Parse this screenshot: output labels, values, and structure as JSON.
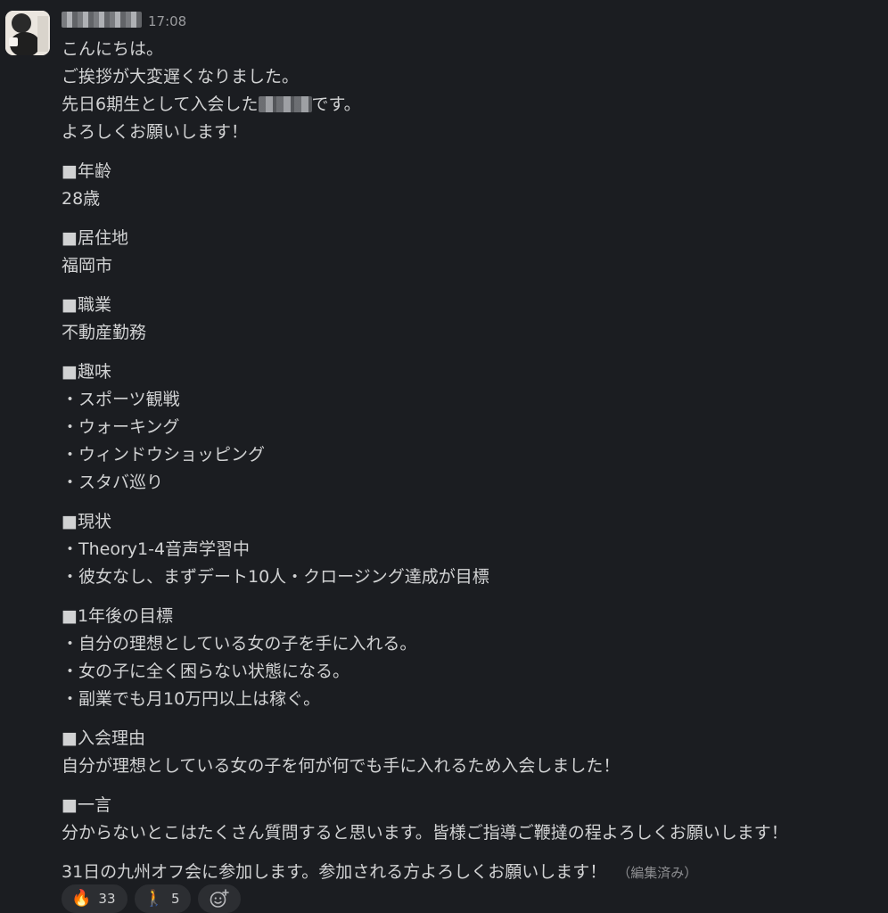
{
  "message": {
    "timestamp": "17:08",
    "greeting": [
      "こんにちは。",
      "ご挨拶が大変遅くなりました。"
    ],
    "intro_prefix": "先日6期生として入会した",
    "intro_suffix": "です。",
    "intro_closing": "よろしくお願いします！",
    "sections": {
      "age": {
        "title": "■年齢",
        "lines": [
          " 28歳"
        ]
      },
      "residence": {
        "title": "■居住地",
        "lines": [
          "福岡市"
        ]
      },
      "occupation": {
        "title": "■職業",
        "lines": [
          "不動産勤務"
        ]
      },
      "hobbies": {
        "title": "■趣味",
        "lines": [
          "・スポーツ観戦",
          "・ウォーキング",
          "・ウィンドウショッピング",
          "・スタバ巡り"
        ]
      },
      "status": {
        "title": "■現状",
        "lines": [
          "・Theory1-4音声学習中",
          "・彼女なし、まずデート10人・クロージング達成が目標"
        ]
      },
      "goals": {
        "title": "■1年後の目標",
        "lines": [
          "・自分の理想としている女の子を手に入れる。",
          "・女の子に全く困らない状態になる。",
          "・副業でも月10万円以上は稼ぐ。"
        ]
      },
      "reason": {
        "title": "■入会理由",
        "lines": [
          "自分が理想としている女の子を何が何でも手に入れるため入会しました！"
        ]
      },
      "comment": {
        "title": "■一言",
        "lines": [
          "分からないとこはたくさん質問すると思います。皆様ご指導ご鞭撻の程よろしくお願いします！"
        ]
      }
    },
    "final_line": "31日の九州オフ会に参加します。参加される方よろしくお願いします！",
    "edited_label": "（編集済み）"
  },
  "reactions": [
    {
      "emoji": "🔥",
      "icon": "fire-icon",
      "count": "33"
    },
    {
      "emoji": "🚶",
      "icon": "walking-person-icon",
      "count": "5"
    }
  ],
  "add_reaction_icon": "add-reaction-icon"
}
